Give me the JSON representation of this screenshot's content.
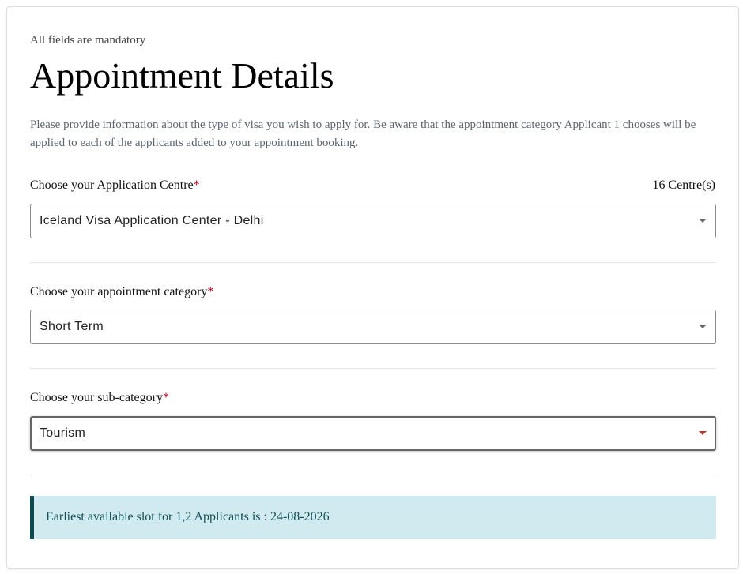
{
  "form": {
    "mandatory_note": "All fields are mandatory",
    "title": "Appointment Details",
    "intro": "Please provide information about the type of visa you wish to apply for. Be aware that the appointment category Applicant 1 chooses will be applied to each of the applicants added to your appointment booking.",
    "required_marker": "*"
  },
  "centre": {
    "label": "Choose your Application Centre",
    "count": "16 Centre(s)",
    "value": "Iceland Visa Application Center - Delhi"
  },
  "category": {
    "label": "Choose your appointment category",
    "value": "Short Term"
  },
  "subcategory": {
    "label": "Choose your sub-category",
    "value": "Tourism"
  },
  "slot": {
    "message": "Earliest available slot for 1,2 Applicants is : 24-08-2026"
  },
  "colors": {
    "required": "#b00020",
    "banner_bg": "#d1eaf0",
    "banner_accent": "#0c4a50",
    "focused_caret": "#b03a2e"
  },
  "icons": {
    "dropdown": "chevron-down-icon"
  }
}
